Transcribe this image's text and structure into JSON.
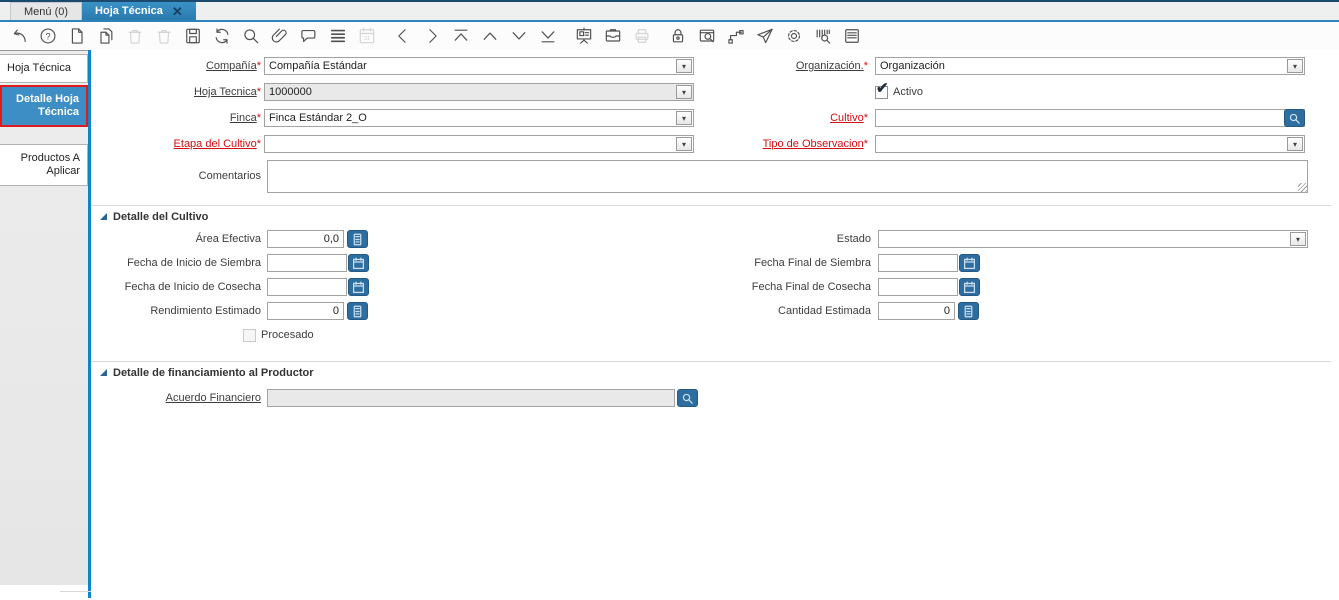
{
  "ui": {
    "dropdown_arrow": "▾",
    "check_mark": "✔"
  },
  "tabbar": {
    "menu_label": "Menú (0)",
    "active_label": "Hoja Técnica",
    "close_glyph": "✕"
  },
  "toolbar": {
    "icons": [
      {
        "name": "undo",
        "icon": "i-undo"
      },
      {
        "name": "help",
        "icon": "i-help"
      },
      {
        "name": "new-record",
        "icon": "i-new"
      },
      {
        "name": "copy-record",
        "icon": "i-copy"
      },
      {
        "name": "delete-record",
        "icon": "i-delete",
        "disabled": true
      },
      {
        "name": "delete-selection",
        "icon": "i-delete",
        "disabled": true
      },
      {
        "name": "save",
        "icon": "i-save"
      },
      {
        "name": "refresh",
        "icon": "i-refresh"
      },
      {
        "name": "find",
        "icon": "i-find"
      },
      {
        "name": "attachment",
        "icon": "i-attach"
      },
      {
        "name": "chat",
        "icon": "i-chat"
      },
      {
        "name": "grid-toggle",
        "icon": "i-grid"
      },
      {
        "name": "calendar",
        "icon": "i-calendar",
        "disabled": true
      },
      {
        "name": "previous-record",
        "icon": "i-prev",
        "group_start": true
      },
      {
        "name": "next-record",
        "icon": "i-next"
      },
      {
        "name": "first-record",
        "icon": "i-first"
      },
      {
        "name": "parent-record",
        "icon": "i-parent"
      },
      {
        "name": "detail-record",
        "icon": "i-detail"
      },
      {
        "name": "last-record",
        "icon": "i-last"
      },
      {
        "name": "dashboard",
        "icon": "i-board",
        "group_start": true
      },
      {
        "name": "archive",
        "icon": "i-archive"
      },
      {
        "name": "print",
        "icon": "i-print",
        "disabled": true
      },
      {
        "name": "private-record-lock",
        "icon": "i-lock",
        "group_start": true
      },
      {
        "name": "zoom-across",
        "icon": "i-zoomwin"
      },
      {
        "name": "workflow",
        "icon": "i-workflow"
      },
      {
        "name": "send-mail",
        "icon": "i-send"
      },
      {
        "name": "preference",
        "icon": "i-gear"
      },
      {
        "name": "product-info",
        "icon": "i-barcode"
      },
      {
        "name": "report",
        "icon": "i-report"
      }
    ]
  },
  "sidebar": {
    "tabs": [
      {
        "label": "Hoja Técnica"
      },
      {
        "label": "Detalle Hoja Técnica"
      },
      {
        "label": "Productos A Aplicar"
      }
    ]
  },
  "form": {
    "compania": {
      "label": "Compañía",
      "req": "*",
      "value": "Compañía Estándar"
    },
    "organizacion": {
      "label": "Organización.",
      "req": "*",
      "value": "Organización"
    },
    "hoja_tecnica": {
      "label": "Hoja Tecnica",
      "req": "*",
      "value": "1000000"
    },
    "activo": {
      "label": "Activo"
    },
    "finca": {
      "label": "Finca",
      "req": "*",
      "value": "Finca Estándar 2_O"
    },
    "cultivo": {
      "label": "Cultivo",
      "req": "*",
      "value": ""
    },
    "etapa_del_cultivo": {
      "label": "Etapa del Cultivo",
      "req": "*",
      "value": ""
    },
    "tipo_de_observacion": {
      "label": "Tipo de Observacion",
      "req": "*",
      "value": ""
    },
    "comentarios": {
      "label": "Comentarios",
      "value": ""
    }
  },
  "section_cultivo": {
    "title": "Detalle del Cultivo",
    "area_efectiva": {
      "label": "Área Efectiva",
      "value": "0,0"
    },
    "estado": {
      "label": "Estado",
      "value": ""
    },
    "fecha_inicio_siembra": {
      "label": "Fecha de Inicio de Siembra",
      "value": ""
    },
    "fecha_final_siembra": {
      "label": "Fecha Final de Siembra",
      "value": ""
    },
    "fecha_inicio_cosecha": {
      "label": "Fecha de Inicio de Cosecha",
      "value": ""
    },
    "fecha_final_cosecha": {
      "label": "Fecha Final de Cosecha",
      "value": ""
    },
    "rendimiento_estimado": {
      "label": "Rendimiento Estimado",
      "value": "0"
    },
    "cantidad_estimada": {
      "label": "Cantidad Estimada",
      "value": "0"
    },
    "procesado": {
      "label": "Procesado"
    }
  },
  "section_financiamiento": {
    "title": "Detalle de financiamiento al Productor",
    "acuerdo_financiero": {
      "label": "Acuerdo Financiero",
      "value": ""
    }
  },
  "colors": {
    "accent_blue": "#2e84ba",
    "selected_tab_blue": "#3e8ec6",
    "selected_tab_border_red": "#e01b1b",
    "button_blue": "#2d6d9f",
    "required_red": "#d40f0f"
  }
}
